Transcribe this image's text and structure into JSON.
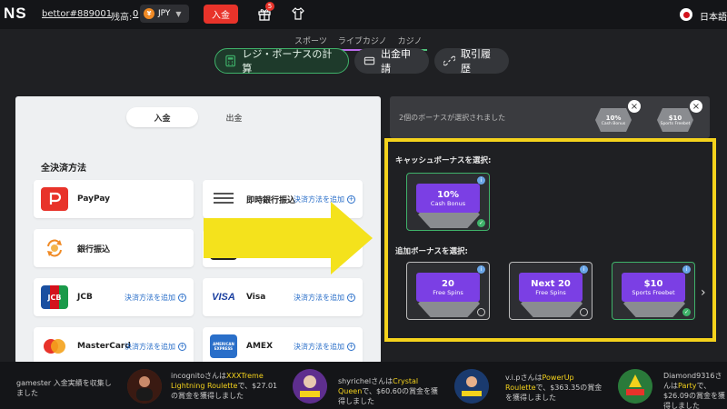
{
  "header": {
    "logo": "NS",
    "username": "bettor#889001",
    "balance_label": "残高:",
    "balance_value": "0",
    "currency": "JPY",
    "coin_symbol": "¥",
    "deposit_label": "入金",
    "gift_count": "5",
    "language": "日本語"
  },
  "subnav": [
    "スポーツ",
    "ライブカジノ",
    "カジノ"
  ],
  "tabs": [
    {
      "label": "レジ・ボーナスの計算",
      "active": true
    },
    {
      "label": "出金申請",
      "active": false
    },
    {
      "label": "取引履歴",
      "active": false
    }
  ],
  "payment": {
    "toggle_deposit": "入金",
    "toggle_withdraw": "出金",
    "section_title": "全決済方法",
    "add_label": "決済方法を追加",
    "methods": [
      {
        "name": "PayPay",
        "icon": "paypay-icon",
        "has_add": false
      },
      {
        "name": "即時銀行振込",
        "icon": "instant-bank-icon",
        "has_add": true
      },
      {
        "name": "銀行振込",
        "icon": "bank-transfer-icon",
        "has_add": false
      },
      {
        "name": "",
        "icon": "hidden-method-icon",
        "has_add": true
      },
      {
        "name": "JCB",
        "icon": "jcb-icon",
        "icon_text": "JCB",
        "has_add": true
      },
      {
        "name": "Visa",
        "icon": "visa-icon",
        "icon_text": "VISA",
        "has_add": true
      },
      {
        "name": "MasterCard",
        "icon": "mastercard-icon",
        "has_add": true
      },
      {
        "name": "AMEX",
        "icon": "amex-icon",
        "icon_text": "AMERICAN EXPRESS",
        "has_add": true
      }
    ]
  },
  "bonus": {
    "selected_text": "2個のボーナスが選択されました",
    "chips": [
      {
        "value": "10%",
        "sub": "Cash Bonus"
      },
      {
        "value": "$10",
        "sub": "Sports Freebet"
      }
    ],
    "cash_title": "キャッシュボーナスを選択:",
    "extra_title": "追加ボーナスを選択:",
    "cash_cards": [
      {
        "value": "10%",
        "sub": "Cash Bonus",
        "selected": true
      }
    ],
    "extra_cards": [
      {
        "value": "20",
        "sub": "Free Spins",
        "selected": false
      },
      {
        "value": "Next 20",
        "sub": "Free Spins",
        "selected": false
      },
      {
        "value": "$10",
        "sub": "Sports Freebet",
        "selected": true
      }
    ]
  },
  "ticker": {
    "items": [
      {
        "text_pre": "gamester 入金実績を収集しました",
        "hl": "",
        "text_post": ""
      },
      {
        "text_pre": "incognitoさんは",
        "hl": "XXXTreme Lightning Roulette",
        "text_post": "で、$27.01の賞金を獲得しました"
      },
      {
        "text_pre": "shyrichelさんは",
        "hl": "Crystal Queen",
        "text_post": "で、$60.60の賞金を獲得しました"
      },
      {
        "text_pre": "v.i.pさんは",
        "hl": "PowerUp Roulette",
        "text_post": "で、$363.35の賞金を獲得しました"
      },
      {
        "text_pre": "Diamond9316さんは",
        "hl": "Party",
        "text_post": "で、$26.09の賞金を獲得しました"
      }
    ]
  },
  "colors": {
    "accent_green": "#3fb26a",
    "accent_red": "#e8332a",
    "highlight_yellow": "#f4d21c",
    "bonus_purple": "#7b3fe4"
  }
}
